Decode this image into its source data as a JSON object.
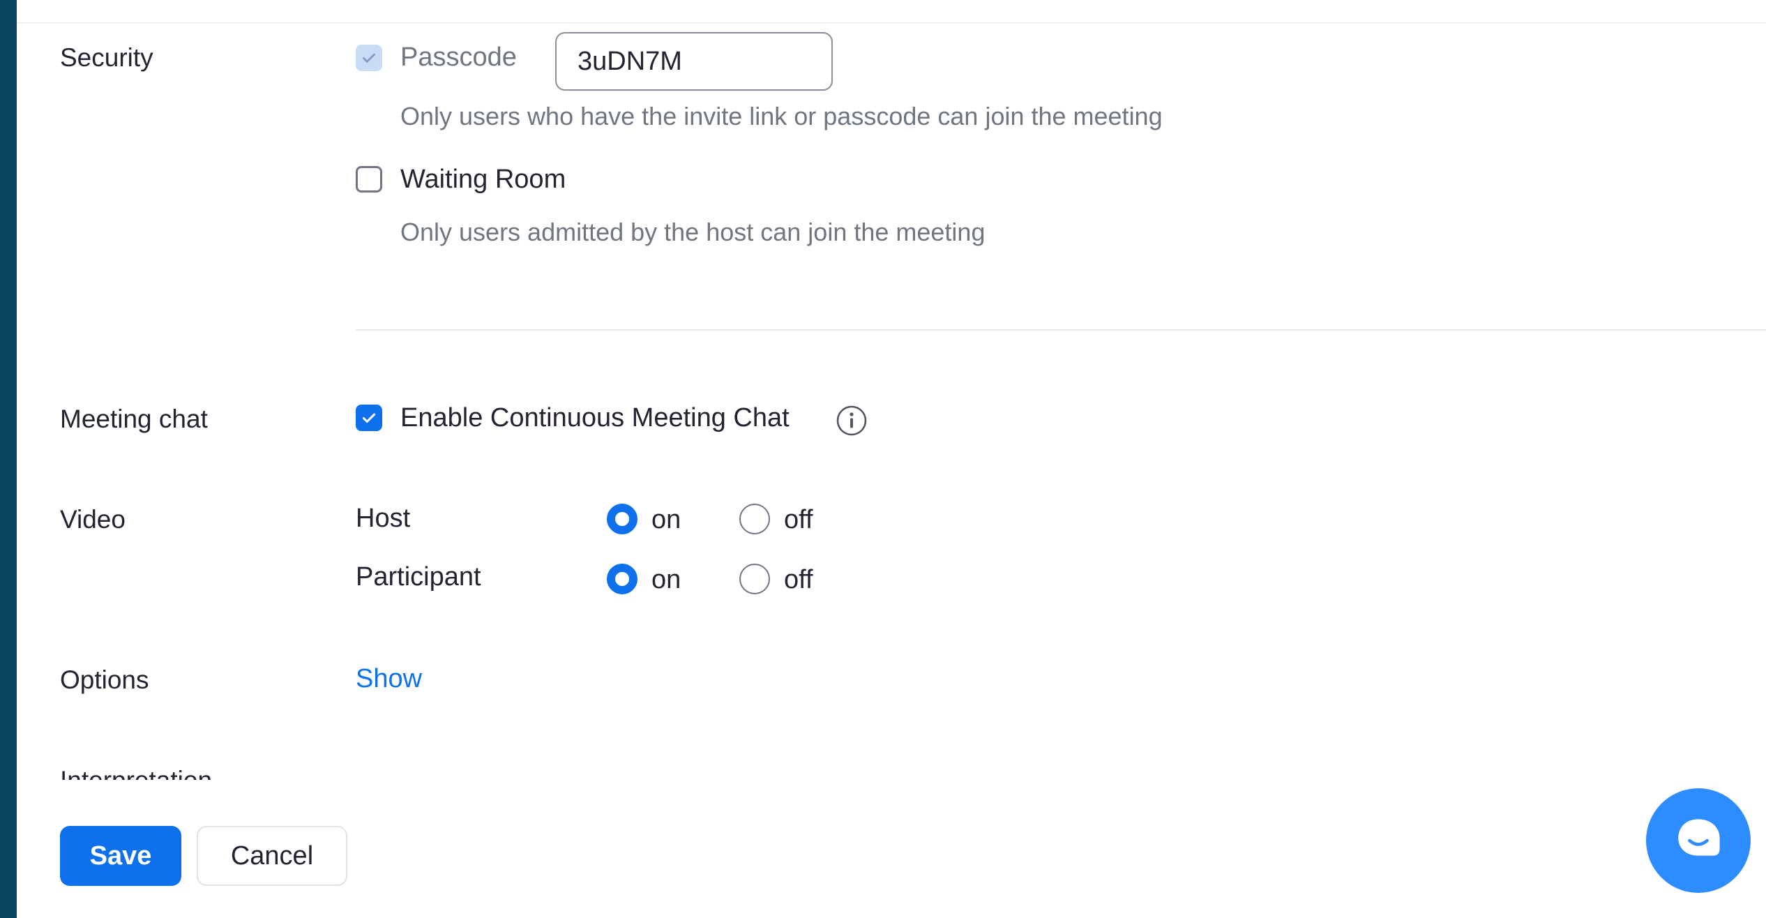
{
  "security": {
    "label": "Security",
    "passcode": {
      "label": "Passcode",
      "value": "3uDN7M",
      "checked": true,
      "disabled": true,
      "hint": "Only users who have the invite link or passcode can join the meeting"
    },
    "waiting_room": {
      "label": "Waiting Room",
      "checked": false,
      "hint": "Only users admitted by the host can join the meeting"
    }
  },
  "meeting_chat": {
    "label": "Meeting chat",
    "option_label": "Enable Continuous Meeting Chat",
    "checked": true,
    "info_icon": "info-circle-icon"
  },
  "video": {
    "label": "Video",
    "rows": [
      {
        "label": "Host",
        "on_label": "on",
        "off_label": "off",
        "selected": "on"
      },
      {
        "label": "Participant",
        "on_label": "on",
        "off_label": "off",
        "selected": "on"
      }
    ]
  },
  "options": {
    "label": "Options",
    "link": "Show"
  },
  "interpretation": {
    "label": "Interpretation"
  },
  "footer": {
    "save_label": "Save",
    "cancel_label": "Cancel"
  },
  "chat_fab": {
    "icon": "chat-bubble-icon"
  },
  "colors": {
    "accent": "#0e71eb",
    "link": "#0e72ed",
    "frame": "#0a4560",
    "hint": "#6e7680"
  }
}
